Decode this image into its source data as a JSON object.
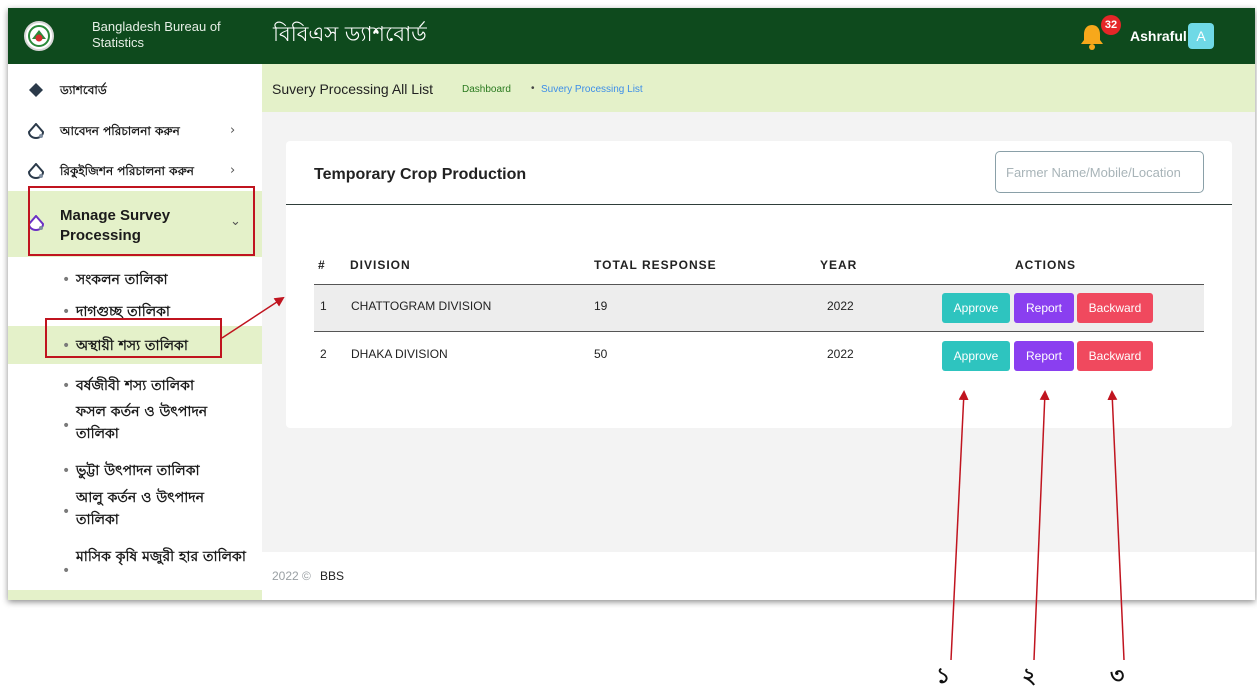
{
  "header": {
    "org_name": "Bangladesh Bureau of Statistics",
    "app_title": "বিবিএস ড্যাশবোর্ড",
    "notification_count": "32",
    "username": "Ashraful",
    "avatar_initial": "A",
    "bar_color": "#0e4a1d"
  },
  "sidebar": {
    "items": [
      {
        "label": "ড্যাশবোর্ড"
      },
      {
        "label": "আবেদন পরিচালনা করুন",
        "chevron": "›"
      },
      {
        "label": "রিকুইজিশন পরিচালনা করুন",
        "chevron": "›"
      },
      {
        "label": "Manage Survey Processing",
        "chevron": "⌄"
      }
    ],
    "subitems": [
      {
        "label": "সংকলন তালিকা"
      },
      {
        "label": "দাগগুচ্ছ তালিকা"
      },
      {
        "label": "অস্থায়ী শস্য তালিকা",
        "active": true
      },
      {
        "label": "বর্ষজীবী শস্য তালিকা"
      },
      {
        "label": "ফসল কর্তন ও উৎপাদন তালিকা"
      },
      {
        "label": "ভুট্টা উৎপাদন তালিকা"
      },
      {
        "label": "আলু কর্তন ও উৎপাদন তালিকা"
      },
      {
        "label": "মাসিক কৃষি মজুরী হার তালিকা"
      }
    ],
    "active_bg": "#e4f1c9"
  },
  "breadcrumb": {
    "title": "Suvery Processing All List",
    "home": "Dashboard",
    "separator": "•",
    "current": "Suvery Processing List"
  },
  "card": {
    "title": "Temporary Crop Production",
    "search_placeholder": "Farmer Name/Mobile/Location",
    "columns": [
      "#",
      "DIVISION",
      "TOTAL RESPONSE",
      "YEAR",
      "ACTIONS"
    ],
    "rows": [
      {
        "index": "1",
        "division": "CHATTOGRAM DIVISION",
        "total_response": "19",
        "year": "2022"
      },
      {
        "index": "2",
        "division": "DHAKA DIVISION",
        "total_response": "50",
        "year": "2022"
      }
    ],
    "actions": {
      "approve": "Approve",
      "report": "Report",
      "backward": "Backward"
    },
    "action_colors": {
      "approve": "#2ec4bf",
      "report": "#8a3ff0",
      "backward": "#f0495e"
    }
  },
  "footer": {
    "year": "2022 ©",
    "org": "BBS"
  },
  "annotations": {
    "numbers": [
      "১",
      "২",
      "৩"
    ],
    "color": "#c0141f"
  }
}
